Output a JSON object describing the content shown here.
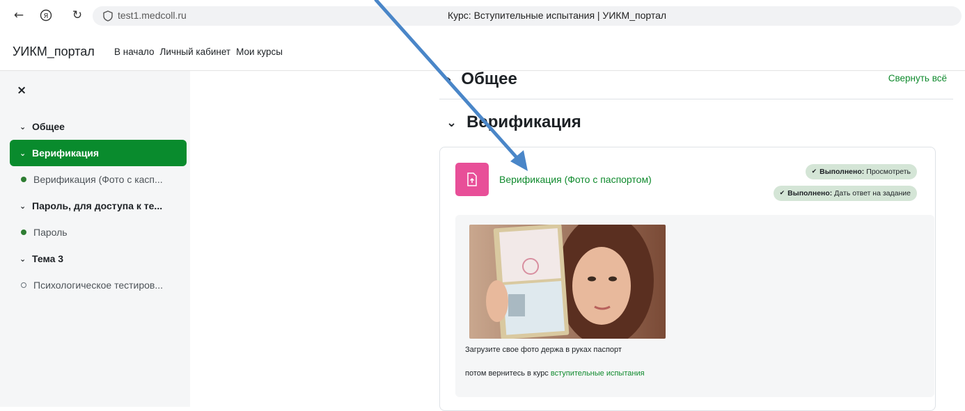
{
  "browser": {
    "url": "test1.medcoll.ru",
    "tab_title": "Курс: Вступительные испытания | УИКМ_портал",
    "icons": [
      "back-arrow-icon",
      "yandex-icon",
      "reload-icon",
      "shield-icon"
    ]
  },
  "navbar": {
    "brand": "УИКМ_портал",
    "links": [
      "В начало",
      "Личный кабинет",
      "Мои курсы"
    ]
  },
  "sidebar": {
    "close_glyph": "×",
    "items": [
      {
        "label": "Общее",
        "type": "section"
      },
      {
        "label": "Верификация",
        "type": "section-active"
      },
      {
        "label": "Верификация (Фото с касп...",
        "type": "activity-complete"
      },
      {
        "label": "Пароль, для доступа к те...",
        "type": "section"
      },
      {
        "label": "Пароль",
        "type": "activity-complete"
      },
      {
        "label": "Тема 3",
        "type": "section"
      },
      {
        "label": "Психологическое тестиров...",
        "type": "activity-incomplete"
      }
    ]
  },
  "main": {
    "section_general": "Общее",
    "collapse_all": "Свернуть всё",
    "section_verification": "Верификация",
    "activity": {
      "title": "Верификация (Фото с паспортом)",
      "icon": "assignment-upload-icon",
      "icon_color": "#e84f98",
      "completion": [
        {
          "status": "Выполнено:",
          "text": "Просмотреть"
        },
        {
          "status": "Выполнено:",
          "text": "Дать ответ на задание"
        }
      ],
      "description": {
        "line1": "Загрузите свое фото держа в руках паспорт",
        "line2_prefix": "потом вернитесь в курс ",
        "line2_link": "вступительные испытания"
      }
    }
  },
  "colors": {
    "accent": "#098b2d",
    "link": "#0f8a2d",
    "badge_bg": "#d4e5d6",
    "annotation_arrow": "#4a86c8"
  }
}
